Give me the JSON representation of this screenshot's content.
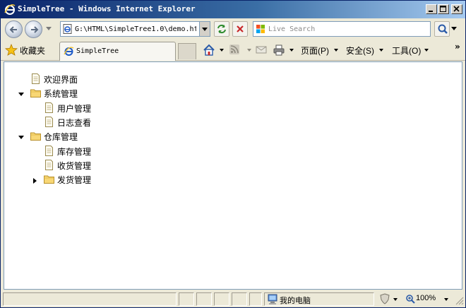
{
  "window": {
    "title": "SimpleTree - Windows Internet Explorer"
  },
  "address_bar": {
    "value": "G:\\HTML\\SimpleTree1.0\\demo.ht"
  },
  "search": {
    "placeholder": "Live Search"
  },
  "command_bar": {
    "favorites_label": "收藏夹",
    "tab_title": "SimpleTree",
    "page_menu": "页面(P)",
    "safety_menu": "安全(S)",
    "tools_menu": "工具(O)",
    "overflow": "»"
  },
  "tree": [
    {
      "label": "欢迎界面",
      "type": "file",
      "depth": 0,
      "expander": "none"
    },
    {
      "label": "系统管理",
      "type": "folder",
      "depth": 0,
      "expander": "expanded"
    },
    {
      "label": "用户管理",
      "type": "file",
      "depth": 1,
      "expander": "none"
    },
    {
      "label": "日志查看",
      "type": "file",
      "depth": 1,
      "expander": "none"
    },
    {
      "label": "仓库管理",
      "type": "folder",
      "depth": 0,
      "expander": "expanded"
    },
    {
      "label": "库存管理",
      "type": "file",
      "depth": 1,
      "expander": "none"
    },
    {
      "label": "收货管理",
      "type": "file",
      "depth": 1,
      "expander": "none"
    },
    {
      "label": "发货管理",
      "type": "folder",
      "depth": 1,
      "expander": "collapsed"
    }
  ],
  "status_bar": {
    "zone": "我的电脑",
    "zoom": "100%"
  },
  "colors": {
    "title_gradient_start": "#0A246A",
    "title_gradient_end": "#A6CAF0",
    "folder": "#F8D775",
    "chrome": "#ECE9D8"
  }
}
